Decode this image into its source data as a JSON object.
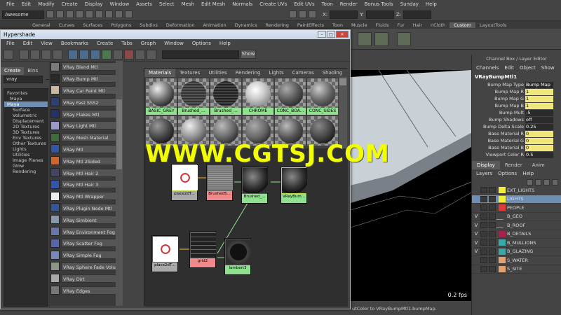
{
  "menubar": [
    "File",
    "Edit",
    "Modify",
    "Create",
    "Display",
    "Window",
    "Assets",
    "Select",
    "Mesh",
    "Edit Mesh",
    "Normals",
    "Create UVs",
    "Edit UVs",
    "Toon",
    "Render",
    "Bonus Tools",
    "Sunday",
    "Help"
  ],
  "statusline": {
    "mode": "Awesome",
    "x_label": "X:",
    "y_label": "Y:",
    "z_label": "Z:"
  },
  "shelf_tabs": [
    "General",
    "Curves",
    "Surfaces",
    "Polygons",
    "Subdivs",
    "Deformation",
    "Animation",
    "Dynamics",
    "Rendering",
    "PaintEffects",
    "Toon",
    "Muscle",
    "Fluids",
    "Fur",
    "Hair",
    "nCloth",
    "Custom",
    "LayoutTools"
  ],
  "shelf_active": "Custom",
  "hypershade": {
    "title": "Hypershade",
    "menu": [
      "File",
      "Edit",
      "View",
      "Bookmarks",
      "Create",
      "Tabs",
      "Graph",
      "Window",
      "Options",
      "Help"
    ],
    "show_button": "Show",
    "left_tabs": [
      "Create",
      "Bins"
    ],
    "filter_value": "vray",
    "tree": [
      "Favorites",
      "Maya",
      "Maya",
      "Surface",
      "Volumetric",
      "Displacement",
      "2D Textures",
      "3D Textures",
      "Env Textures",
      "Other Textures",
      "Lights",
      "Utilities",
      "Image Planes",
      "Glow",
      "Rendering"
    ],
    "nodes": [
      {
        "label": "VRay Blend Mtl",
        "color": "#7a7a7a"
      },
      {
        "label": "VRay Bump Mtl",
        "color": "#2a2a2a"
      },
      {
        "label": "VRay Car Paint Mtl",
        "color": "#ccb8a0"
      },
      {
        "label": "VRay Fast SSS2",
        "color": "#2f3f6f"
      },
      {
        "label": "VRay Flakes Mtl",
        "color": "#223366"
      },
      {
        "label": "VRay Light Mtl",
        "color": "#9999cc"
      },
      {
        "label": "VRay Mesh Material",
        "color": "#3d6d3d"
      },
      {
        "label": "VRay Mtl",
        "color": "#3355aa"
      },
      {
        "label": "VRay Mtl 2Sided",
        "color": "#cc6633"
      },
      {
        "label": "VRay Mtl Hair 2",
        "color": "#444466"
      },
      {
        "label": "VRay Mtl Hair 3",
        "color": "#3355aa"
      },
      {
        "label": "VRay Mtl Wrapper",
        "color": "#eeeeee"
      },
      {
        "label": "VRay Plugin Node Mtl",
        "color": "#335599"
      },
      {
        "label": "VRay Simbiont",
        "color": "#8899aa"
      },
      {
        "label": "VRay Environment Fog",
        "color": "#6677aa"
      },
      {
        "label": "VRay Scatter Fog",
        "color": "#5566aa"
      },
      {
        "label": "VRay Simple Fog",
        "color": "#7788bb"
      },
      {
        "label": "VRay Sphere Fade Volu",
        "color": "#889988"
      },
      {
        "label": "VRay Dirt",
        "color": "#aaaaaa"
      },
      {
        "label": "VRay Edges",
        "color": "#777777"
      }
    ],
    "right_tabs": [
      "Materials",
      "Textures",
      "Utilities",
      "Rendering",
      "Lights",
      "Cameras",
      "Shading"
    ],
    "swatches": [
      {
        "label": "BASIC_GREY",
        "ball": "radial-gradient(circle at 35% 30%, #eee, #777 45%, #222 80%)"
      },
      {
        "label": "Brushed_...",
        "ball": "repeating-linear-gradient(0deg,#555 0 2px,#333 2px 4px)"
      },
      {
        "label": "Brushed_...",
        "ball": "repeating-linear-gradient(0deg,#444 0 2px,#222 2px 4px)"
      },
      {
        "label": "CHROME",
        "ball": "radial-gradient(circle at 40% 35%, #fff, #ccc 40%, #888 80%)"
      },
      {
        "label": "CONC_BOA...",
        "ball": "radial-gradient(circle at 35% 30%, #aaa, #555 50%, #222 85%)"
      },
      {
        "label": "CONC_SIDES",
        "ball": "radial-gradient(circle at 35% 30%, #ccc, #666 50%, #333 85%)"
      }
    ],
    "graph_nodes": [
      {
        "label": "place2dT...",
        "label_color": "#aaaaaa"
      },
      {
        "label": "Brushed5...",
        "label_color": "#f08a8a"
      },
      {
        "label": "Brushed_...",
        "label_color": "#8fe08f"
      },
      {
        "label": "VRayBum...",
        "label_color": "#8fe08f"
      },
      {
        "label": "place2dT...",
        "label_color": "#aaaaaa"
      },
      {
        "label": "grid2",
        "label_color": "#f08a8a"
      },
      {
        "label": "lambert3",
        "label_color": "#8fe08f"
      }
    ]
  },
  "viewport": {
    "fps": "0.2 fps"
  },
  "helpline": "utColor to VRayBumpMtl1.bumpMap.",
  "channel_box": {
    "title": "Channel Box / Layer Editor",
    "menu": [
      "Channels",
      "Edit",
      "Object",
      "Show"
    ],
    "node": "VRayBumpMtl1",
    "attrs": [
      {
        "name": "Bump Map Type",
        "value": "Bump Map",
        "yellow": false
      },
      {
        "name": "Bump Map R",
        "value": "1",
        "yellow": true
      },
      {
        "name": "Bump Map G",
        "value": "1",
        "yellow": true
      },
      {
        "name": "Bump Map B",
        "value": "1",
        "yellow": true
      },
      {
        "name": "Bump Mult",
        "value": "-5",
        "yellow": false
      },
      {
        "name": "Bump Shadows",
        "value": "off",
        "yellow": false
      },
      {
        "name": "Bump Delta Scale",
        "value": "0.25",
        "yellow": false
      },
      {
        "name": "Base Material R",
        "value": "0",
        "yellow": true
      },
      {
        "name": "Base Material G",
        "value": "0",
        "yellow": true
      },
      {
        "name": "Base Material B",
        "value": "0",
        "yellow": true
      },
      {
        "name": "Viewport Color R",
        "value": "0.5",
        "yellow": false
      }
    ],
    "layer_tabs": [
      "Display",
      "Render",
      "Anim"
    ],
    "layer_menu": [
      "Layers",
      "Options",
      "Help"
    ],
    "layers": [
      {
        "name": "EXT_LIGHTS",
        "visible": "",
        "color": "#f2ee3a",
        "selected": false
      },
      {
        "name": "LIGHTS",
        "visible": "",
        "color": "#f2ee3a",
        "selected": true
      },
      {
        "name": "PEOPLE",
        "visible": "",
        "color": "#e03c3c",
        "selected": false
      },
      {
        "name": "B_GEO",
        "visible": "V",
        "color": "",
        "selected": false
      },
      {
        "name": "B_ROOF",
        "visible": "V",
        "color": "",
        "selected": false
      },
      {
        "name": "B_DETAILS",
        "visible": "V",
        "color": "#a8204e",
        "selected": false
      },
      {
        "name": "B_MULLIONS",
        "visible": "V",
        "color": "#3aa8a8",
        "selected": false
      },
      {
        "name": "B_GLAZING",
        "visible": "V",
        "color": "#3aa8a8",
        "selected": false
      },
      {
        "name": "S_WATER",
        "visible": "",
        "color": "#e4a070",
        "selected": false
      },
      {
        "name": "S_SITE",
        "visible": "",
        "color": "#e4a070",
        "selected": false
      }
    ]
  },
  "watermark": "WWW.CGTSJ.COM"
}
